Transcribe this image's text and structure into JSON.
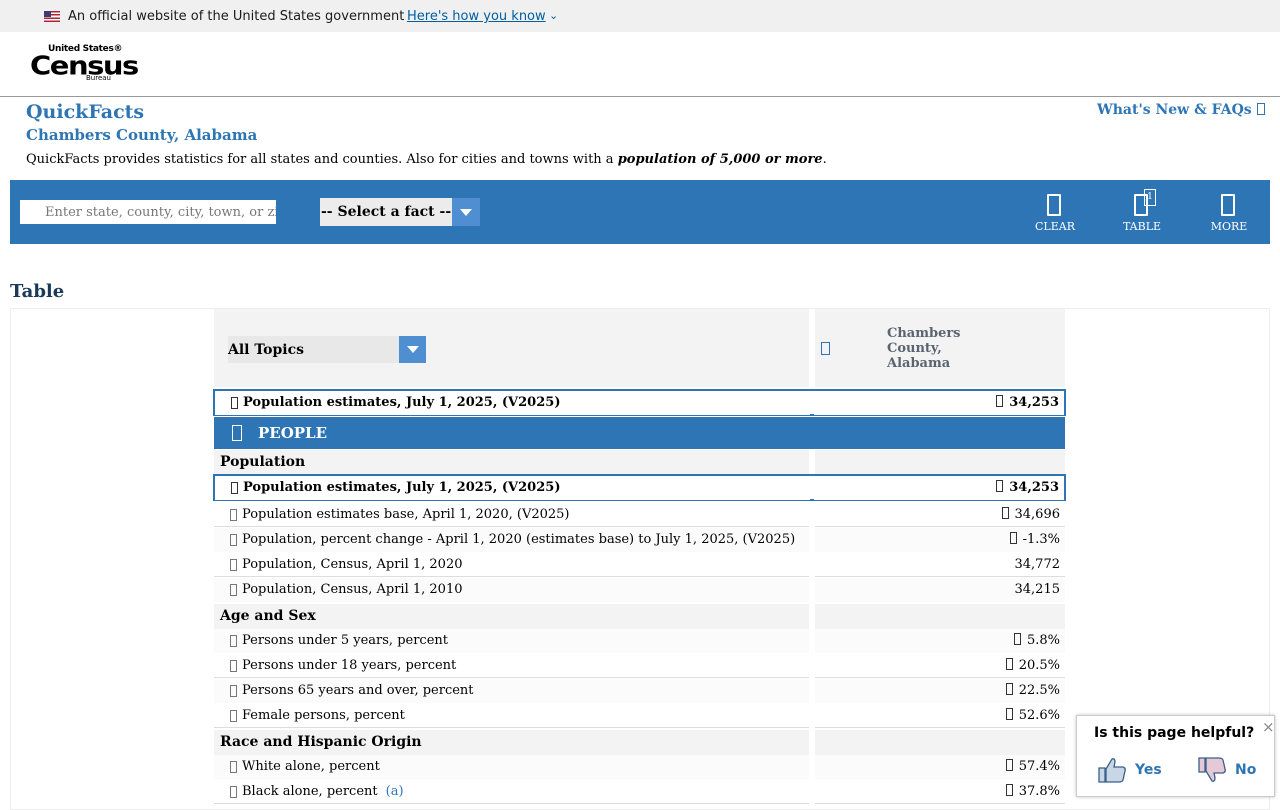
{
  "gov_banner": {
    "text": "An official website of the United States government",
    "link": "Here's how you know",
    "chevron": "⌄"
  },
  "logo": {
    "line1": "United States®",
    "line2": "Census",
    "line3": "Bureau"
  },
  "page": {
    "title": "QuickFacts",
    "subtitle": "Chambers County, Alabama",
    "description_pre": "QuickFacts provides statistics for all states and counties. Also for cities and towns with a ",
    "description_bold": "population of 5,000 or more",
    "description_post": ".",
    "whats_new": "What's New & FAQs",
    "whats_new_icon": "external-link-icon"
  },
  "toolbar": {
    "search_placeholder": "Enter state, county, city, town, or zip code",
    "select_fact": "-- Select a fact --",
    "clear": "CLEAR",
    "table": "TABLE",
    "table_badge": "1",
    "more": "MORE"
  },
  "table": {
    "heading": "Table",
    "topics": "All Topics",
    "column_header": "Chambers County, Alabama",
    "headline_row": {
      "label": "Population estimates, July 1, 2025, (V2025)",
      "value": "34,253"
    },
    "people_header": "PEOPLE",
    "sections": [
      {
        "title": "Population",
        "rows": [
          {
            "label": "Population estimates, July 1, 2025, (V2025)",
            "value": "34,253",
            "highlight": true,
            "value_icon": true
          },
          {
            "label": "Population estimates base, April 1, 2020, (V2025)",
            "value": "34,696",
            "value_icon": true
          },
          {
            "label": "Population, percent change - April 1, 2020 (estimates base) to July 1, 2025, (V2025)",
            "value": "-1.3%",
            "value_icon": true
          },
          {
            "label": "Population, Census, April 1, 2020",
            "value": "34,772",
            "value_icon": false
          },
          {
            "label": "Population, Census, April 1, 2010",
            "value": "34,215",
            "value_icon": false
          }
        ]
      },
      {
        "title": "Age and Sex",
        "rows": [
          {
            "label": "Persons under 5 years, percent",
            "value": "5.8%",
            "value_icon": true
          },
          {
            "label": "Persons under 18 years, percent",
            "value": "20.5%",
            "value_icon": true
          },
          {
            "label": "Persons 65 years and over, percent",
            "value": "22.5%",
            "value_icon": true
          },
          {
            "label": "Female persons, percent",
            "value": "52.6%",
            "value_icon": true
          }
        ]
      },
      {
        "title": "Race and Hispanic Origin",
        "rows": [
          {
            "label": "White alone, percent",
            "value": "57.4%",
            "value_icon": true
          },
          {
            "label": "Black alone, percent",
            "value": "37.8%",
            "value_icon": true,
            "footnote": "(a)"
          }
        ]
      }
    ]
  },
  "feedback": {
    "question": "Is this page helpful?",
    "yes": "Yes",
    "no": "No",
    "close": "×"
  },
  "colors": {
    "brand_blue": "#2e75b6",
    "toolbar_blue": "#2e75b6",
    "link_blue": "#005ea2",
    "header_text": "#1b3a57"
  }
}
